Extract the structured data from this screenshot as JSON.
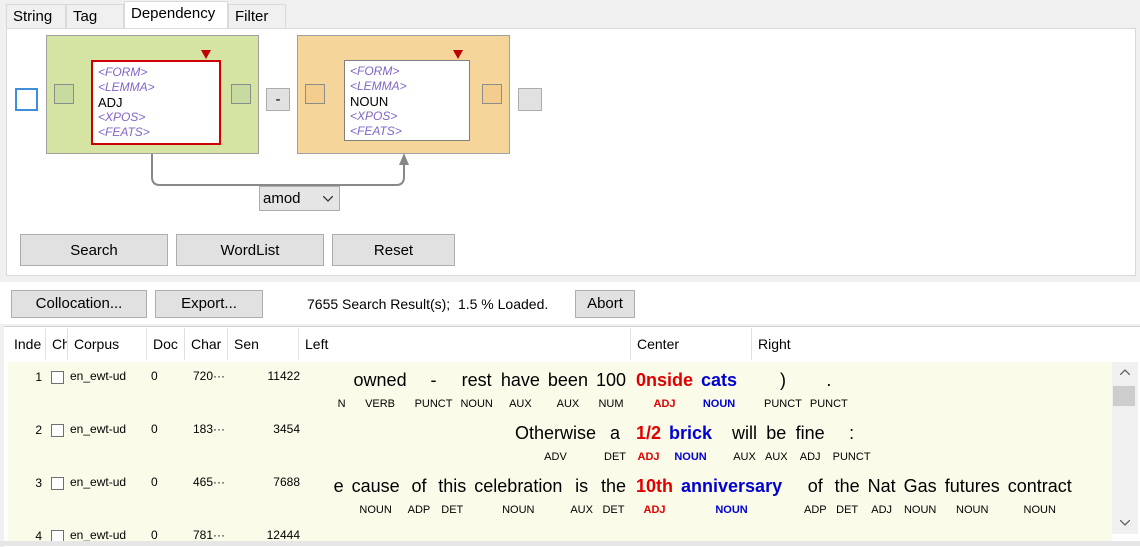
{
  "tabs": [
    "String",
    "Tag",
    "Dependency",
    "Filter"
  ],
  "active_tab": "Dependency",
  "query": {
    "node1": {
      "form": "<FORM>",
      "lemma": "<LEMMA>",
      "upos": "ADJ",
      "xpos": "<XPOS>",
      "feats": "<FEATS>",
      "color": "#d5e4a3"
    },
    "node2": {
      "form": "<FORM>",
      "lemma": "<LEMMA>",
      "upos": "NOUN",
      "xpos": "<XPOS>",
      "feats": "<FEATS>",
      "color": "#f5d59a"
    },
    "connector": "-",
    "relation": "amod"
  },
  "buttons": {
    "search": "Search",
    "wordlist": "WordList",
    "reset": "Reset",
    "collocation": "Collocation...",
    "export": "Export...",
    "abort": "Abort"
  },
  "status": "7655 Search Result(s);  1.5 % Loaded.",
  "columns": {
    "index": "Inde",
    "check": "Ch",
    "corpus": "Corpus",
    "doc": "Doc",
    "char": "Char",
    "sen": "Sen",
    "left": "Left",
    "center": "Center",
    "right": "Right"
  },
  "rows": [
    {
      "index": "1",
      "corpus": "en_ewt-ud",
      "doc": "0",
      "char": "720···",
      "sen": "11422",
      "left": [
        {
          "f": "",
          "p": "N"
        },
        {
          "f": "owned",
          "p": "VERB"
        },
        {
          "f": "-",
          "p": "PUNCT"
        },
        {
          "f": "rest",
          "p": "NOUN"
        },
        {
          "f": "have",
          "p": "AUX"
        },
        {
          "f": "been",
          "p": "AUX"
        },
        {
          "f": "100",
          "p": "NUM"
        }
      ],
      "center": [
        {
          "f": "0nside",
          "p": "ADJ",
          "k": "adj"
        },
        {
          "f": "cats",
          "p": "NOUN",
          "k": "noun"
        }
      ],
      "right": [
        {
          "f": ")",
          "p": "PUNCT"
        },
        {
          "f": ".",
          "p": "PUNCT"
        }
      ]
    },
    {
      "index": "2",
      "corpus": "en_ewt-ud",
      "doc": "0",
      "char": "183···",
      "sen": "3454",
      "left": [
        {
          "f": "Otherwise",
          "p": "ADV"
        },
        {
          "f": "a",
          "p": "DET"
        }
      ],
      "center": [
        {
          "f": "1/2",
          "p": "ADJ",
          "k": "adj"
        },
        {
          "f": "brick",
          "p": "NOUN",
          "k": "noun"
        }
      ],
      "right": [
        {
          "f": "will",
          "p": "AUX"
        },
        {
          "f": "be",
          "p": "AUX"
        },
        {
          "f": "fine",
          "p": "ADJ"
        },
        {
          "f": ":",
          "p": "PUNCT"
        }
      ]
    },
    {
      "index": "3",
      "corpus": "en_ewt-ud",
      "doc": "0",
      "char": "465···",
      "sen": "7688",
      "left": [
        {
          "f": "e",
          "p": ""
        },
        {
          "f": "cause",
          "p": "NOUN"
        },
        {
          "f": "of",
          "p": "ADP"
        },
        {
          "f": "this",
          "p": "DET"
        },
        {
          "f": "celebration",
          "p": "NOUN"
        },
        {
          "f": "is",
          "p": "AUX"
        },
        {
          "f": "the",
          "p": "DET"
        }
      ],
      "center": [
        {
          "f": "10th",
          "p": "ADJ",
          "k": "adj"
        },
        {
          "f": "anniversary",
          "p": "NOUN",
          "k": "noun"
        }
      ],
      "right": [
        {
          "f": "of",
          "p": "ADP"
        },
        {
          "f": "the",
          "p": "DET"
        },
        {
          "f": "Nat",
          "p": "ADJ"
        },
        {
          "f": "Gas",
          "p": "NOUN"
        },
        {
          "f": "futures",
          "p": "NOUN"
        },
        {
          "f": "contract",
          "p": "NOUN"
        }
      ]
    },
    {
      "index": "4",
      "corpus": "en_ewt-ud",
      "doc": "0",
      "char": "781···",
      "sen": "12444"
    }
  ]
}
